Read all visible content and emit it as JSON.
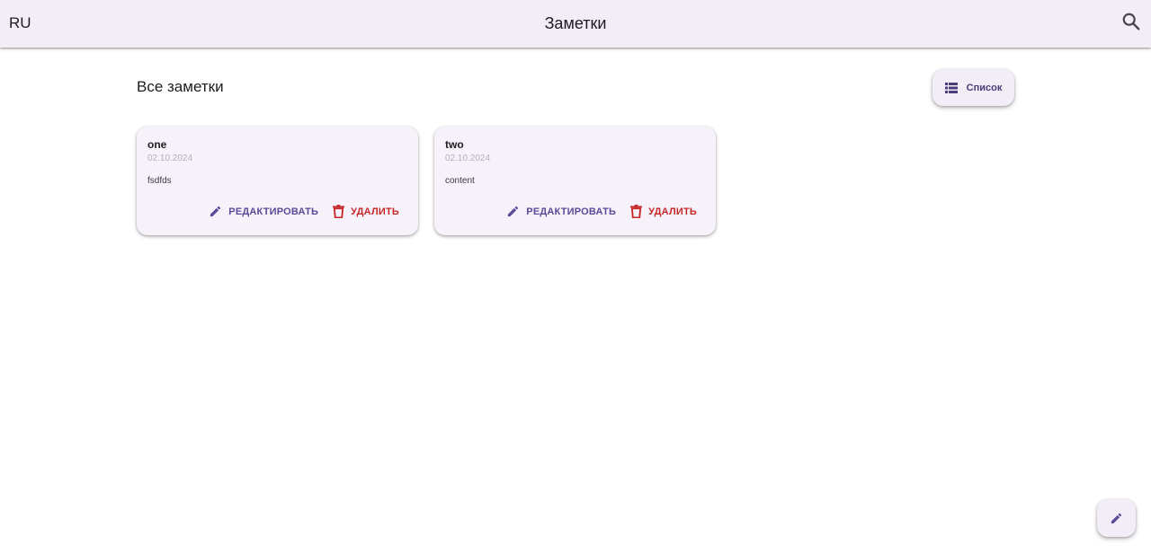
{
  "app_bar": {
    "language": "RU",
    "title": "Заметки",
    "search_icon": "search-icon"
  },
  "main": {
    "section_title": "Все заметки",
    "view_toggle": {
      "label": "Список",
      "icon": "list-icon"
    }
  },
  "notes": [
    {
      "title": "one",
      "date": "02.10.2024",
      "content": "fsdfds",
      "edit_label": "РЕДАКТИРОВАТЬ",
      "delete_label": "УДАЛИТЬ"
    },
    {
      "title": "two",
      "date": "02.10.2024",
      "content": "content",
      "edit_label": "РЕДАКТИРОВАТЬ",
      "delete_label": "УДАЛИТЬ"
    }
  ],
  "fab": {
    "icon": "pencil-icon"
  },
  "colors": {
    "app_bar_bg": "#f3edf7",
    "accent": "#5b4a99",
    "danger": "#c62828"
  }
}
